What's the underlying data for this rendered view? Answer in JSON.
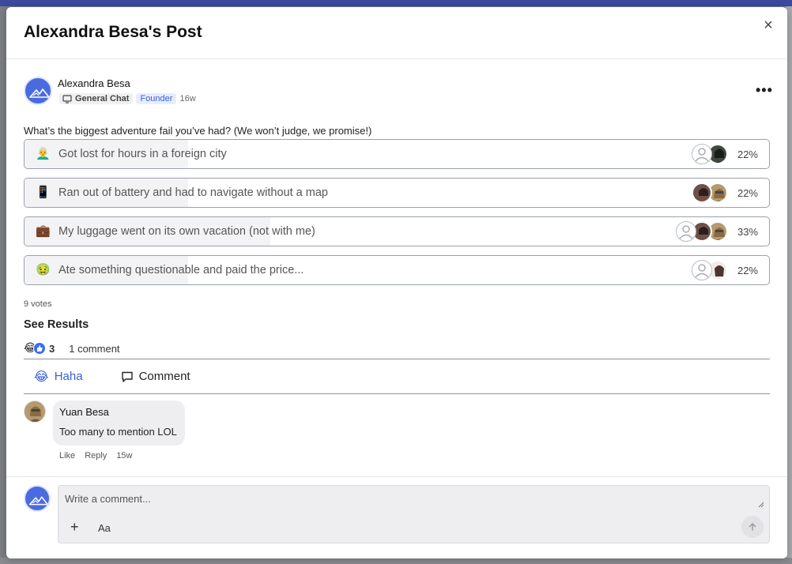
{
  "modal": {
    "title": "Alexandra Besa's Post",
    "close_label": "×"
  },
  "post": {
    "author": "Alexandra Besa",
    "space": "General Chat",
    "role": "Founder",
    "time": "16w",
    "more_label": "•••",
    "question": "What’s the biggest adventure fail you’ve had? (We won’t judge, we promise!)"
  },
  "poll": {
    "options": [
      {
        "emoji": "👨‍🦳",
        "label": "Got lost for hours in a foreign city",
        "percent": "22%",
        "fill": 0.22,
        "voters": 2
      },
      {
        "emoji": "📱",
        "label": "Ran out of battery and had to navigate without a map",
        "percent": "22%",
        "fill": 0.22,
        "voters": 2
      },
      {
        "emoji": "💼",
        "label": "My luggage went on its own vacation (not with me)",
        "percent": "33%",
        "fill": 0.33,
        "voters": 3
      },
      {
        "emoji": "🤢",
        "label": "Ate something questionable and paid the price...",
        "percent": "22%",
        "fill": 0.22,
        "voters": 2
      }
    ],
    "votes": "9 votes",
    "see_results": "See Results"
  },
  "reactions": {
    "count": "3",
    "comments": "1 comment"
  },
  "actions": {
    "haha": "Haha",
    "comment": "Comment"
  },
  "comment": {
    "author": "Yuan Besa",
    "text": "Too many to mention LOL",
    "like": "Like",
    "reply": "Reply",
    "time": "15w"
  },
  "composer": {
    "placeholder": "Write a comment...",
    "font_label": "Aa",
    "add_label": "+"
  },
  "colors": {
    "accent": "#3860d8",
    "brand": "#4a6be0"
  }
}
